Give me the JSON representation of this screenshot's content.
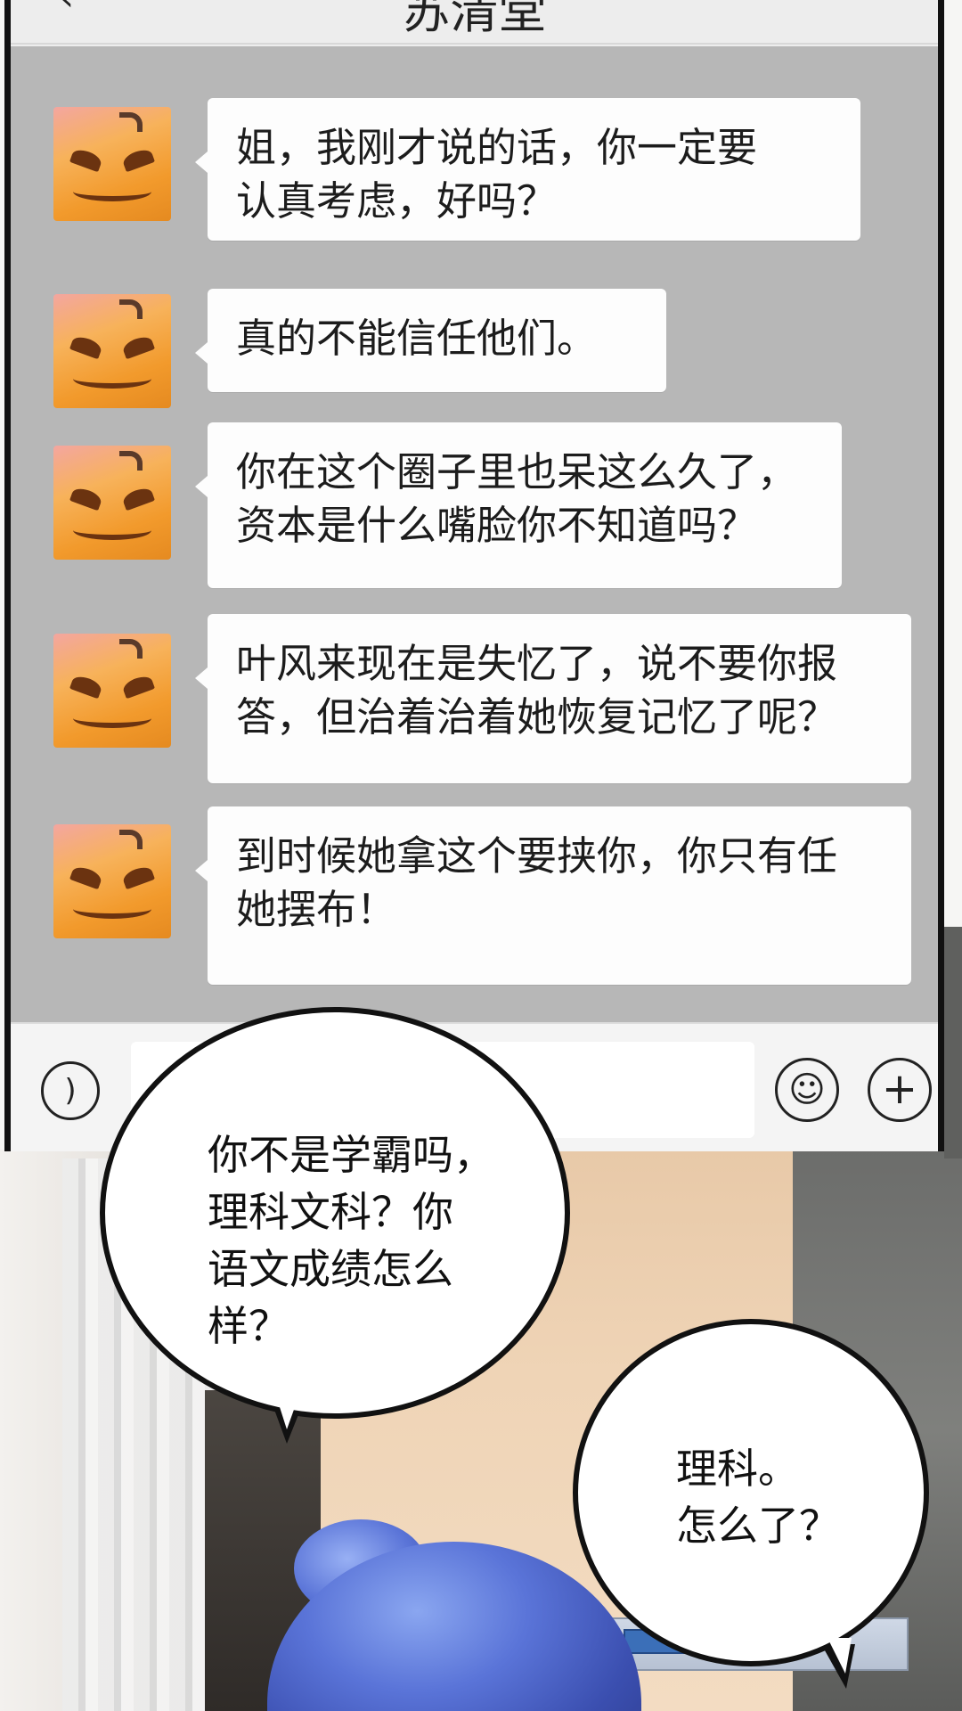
{
  "chat": {
    "title": "苏清堂",
    "back_icon": "chevron-left-icon",
    "messages": [
      {
        "avatar": "pumpkin-avatar",
        "text": "姐，我刚才说的话，你一定要\n认真考虑，好吗？"
      },
      {
        "avatar": "pumpkin-avatar",
        "text": "真的不能信任他们。"
      },
      {
        "avatar": "pumpkin-avatar",
        "text": "你在这个圈子里也呆这么久了，\n资本是什么嘴脸你不知道吗？"
      },
      {
        "avatar": "pumpkin-avatar",
        "text": "叶风来现在是失忆了，说不要你报\n答，但治着治着她恢复记忆了呢？"
      },
      {
        "avatar": "pumpkin-avatar",
        "text": "到时候她拿这个要挟你，你只有任\n她摆布！"
      }
    ]
  },
  "input_bar": {
    "voice_icon": "voice-icon",
    "input_value": "",
    "emoji_icon": "smiley-icon",
    "plus_icon": "plus-icon"
  },
  "balloons": {
    "left": "你不是学霸吗，\n理科文科？你\n语文成绩怎么\n样？",
    "right": "理科。\n怎么了？"
  },
  "colors": {
    "chat_background": "#b7b7b7",
    "bubble": "#fdfdfd",
    "bar": "#ededed",
    "hair": "#5a74d8"
  }
}
